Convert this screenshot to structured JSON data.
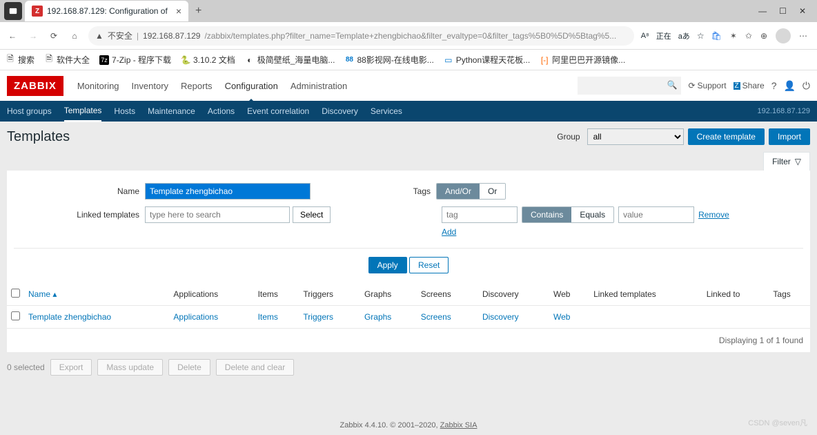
{
  "browser": {
    "tab_title": "192.168.87.129: Configuration of",
    "url_insecure": "不安全",
    "url_host": "192.168.87.129",
    "url_path": "/zabbix/templates.php?filter_name=Template+zhengbichao&filter_evaltype=0&filter_tags%5B0%5D%5Btag%5...",
    "status_text": "正在",
    "win": {
      "min": "—",
      "max": "☐",
      "close": "✕"
    },
    "bookmarks": [
      {
        "label": "搜索"
      },
      {
        "label": "软件大全"
      },
      {
        "label": "7-Zip - 程序下载"
      },
      {
        "label": "3.10.2 文档"
      },
      {
        "label": "极简壁纸_海量电脑..."
      },
      {
        "label": "88影视网-在线电影..."
      },
      {
        "label": "Python课程天花板..."
      },
      {
        "label": "阿里巴巴开源镜像..."
      }
    ]
  },
  "header": {
    "logo": "ZABBIX",
    "nav": [
      "Monitoring",
      "Inventory",
      "Reports",
      "Configuration",
      "Administration"
    ],
    "nav_active": "Configuration",
    "support": "Support",
    "share": "Share"
  },
  "subnav": {
    "items": [
      "Host groups",
      "Templates",
      "Hosts",
      "Maintenance",
      "Actions",
      "Event correlation",
      "Discovery",
      "Services"
    ],
    "active": "Templates",
    "ip": "192.168.87.129"
  },
  "page": {
    "title": "Templates",
    "group_label": "Group",
    "group_value": "all",
    "create": "Create template",
    "import": "Import",
    "filter_label": "Filter"
  },
  "filter": {
    "name_label": "Name",
    "name_value": "Template zhengbichao",
    "linked_label": "Linked templates",
    "linked_placeholder": "type here to search",
    "select_btn": "Select",
    "tags_label": "Tags",
    "andor": "And/Or",
    "or": "Or",
    "tag_placeholder": "tag",
    "contains": "Contains",
    "equals": "Equals",
    "value_placeholder": "value",
    "remove": "Remove",
    "add": "Add",
    "apply": "Apply",
    "reset": "Reset"
  },
  "table": {
    "cols": [
      "Name",
      "Applications",
      "Items",
      "Triggers",
      "Graphs",
      "Screens",
      "Discovery",
      "Web",
      "Linked templates",
      "Linked to",
      "Tags"
    ],
    "sort_col": "Name",
    "rows": [
      {
        "name": "Template zhengbichao",
        "applications": "Applications",
        "items": "Items",
        "triggers": "Triggers",
        "graphs": "Graphs",
        "screens": "Screens",
        "discovery": "Discovery",
        "web": "Web",
        "linked_templates": "",
        "linked_to": "",
        "tags": ""
      }
    ],
    "footer": "Displaying 1 of 1 found"
  },
  "bulk": {
    "selected": "0 selected",
    "buttons": [
      "Export",
      "Mass update",
      "Delete",
      "Delete and clear"
    ]
  },
  "footer": {
    "text": "Zabbix 4.4.10. © 2001–2020, ",
    "link": "Zabbix SIA"
  },
  "watermark": "CSDN @seven凡"
}
